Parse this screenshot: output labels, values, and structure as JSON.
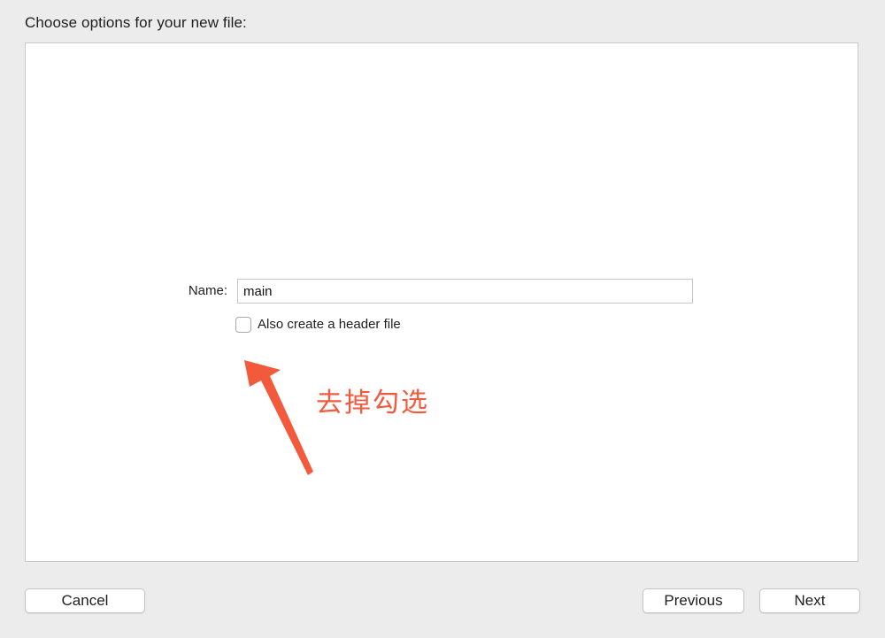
{
  "dialog": {
    "title": "Choose options for your new file:"
  },
  "form": {
    "name_label": "Name:",
    "name_value": "main",
    "header_checkbox_label": "Also create a header file",
    "header_checkbox_checked": false
  },
  "annotation": {
    "text": "去掉勾选",
    "color": "#f25a3b"
  },
  "buttons": {
    "cancel": "Cancel",
    "previous": "Previous",
    "next": "Next"
  }
}
